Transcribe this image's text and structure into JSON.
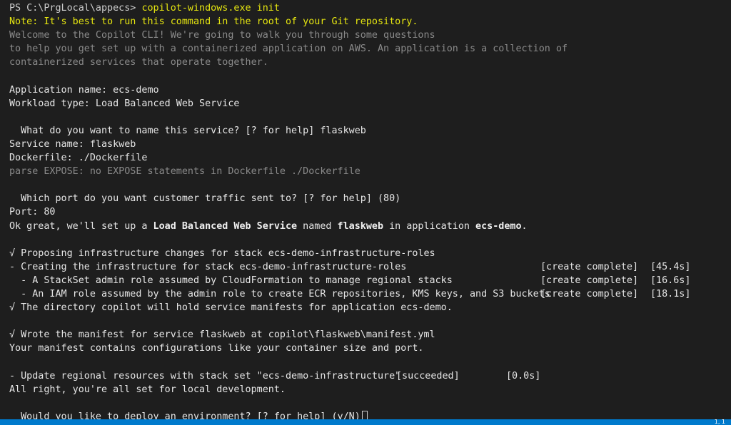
{
  "prompt": {
    "prefix": "PS C:\\PrgLocal\\appecs> ",
    "command": "copilot-windows.exe init"
  },
  "note": "Note: It's best to run this command in the root of your Git repository.",
  "welcome": [
    "Welcome to the Copilot CLI! We're going to walk you through some questions",
    "to help you get set up with a containerized application on AWS. An application is a collection of",
    "containerized services that operate together."
  ],
  "app_name": "Application name: ecs-demo",
  "workload_type": "Workload type: Load Balanced Web Service",
  "q_service_name": "  What do you want to name this service? [? for help] flaskweb",
  "service_name": "Service name: flaskweb",
  "dockerfile": "Dockerfile: ./Dockerfile",
  "parse_expose": "parse EXPOSE: no EXPOSE statements in Dockerfile ./Dockerfile",
  "q_port": "  Which port do you want customer traffic sent to? [? for help] (80)",
  "port": "Port: 80",
  "ok": {
    "p1": "Ok great, we'll set up a ",
    "b1": "Load Balanced Web Service",
    "p2": " named ",
    "b2": "flaskweb",
    "p3": " in application ",
    "b3": "ecs-demo",
    "p4": "."
  },
  "proposing": "√ Proposing infrastructure changes for stack ecs-demo-infrastructure-roles",
  "stack_rows": [
    {
      "text": "- Creating the infrastructure for stack ecs-demo-infrastructure-roles",
      "status": "[create complete]",
      "time": "[45.4s]"
    },
    {
      "text": "  - A StackSet admin role assumed by CloudFormation to manage regional stacks",
      "status": "[create complete]",
      "time": "[16.6s]"
    },
    {
      "text": "  - An IAM role assumed by the admin role to create ECR repositories, KMS keys, and S3 buckets",
      "status": "[create complete]",
      "time": "[18.1s]"
    }
  ],
  "directory": "√ The directory copilot will hold service manifests for application ecs-demo.",
  "wrote": "√ Wrote the manifest for service flaskweb at copilot\\flaskweb\\manifest.yml",
  "manifest_note": "Your manifest contains configurations like your container size and port.",
  "update": {
    "text": "- Update regional resources with stack set \"ecs-demo-infrastructure\"",
    "status": "[succeeded]",
    "time": "[0.0s]"
  },
  "all_right": "All right, you're all set for local development.",
  "q_deploy": "  Would you like to deploy an environment? [? for help] (y/N)",
  "statusbar_text": "1, 1"
}
